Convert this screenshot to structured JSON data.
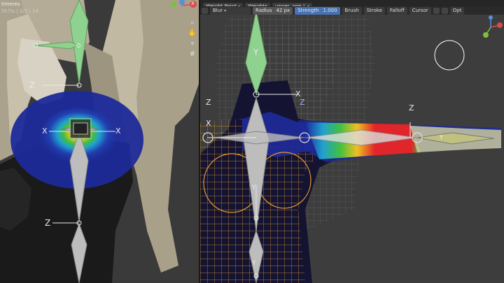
{
  "left_viewport": {
    "info_line1": "timeres",
    "info_line2": "5k7ts | 2/3 | 14",
    "axis_labels": {
      "z1": "Z",
      "x1": "X",
      "x2": "X",
      "z2": "Z"
    },
    "gizmo_axes": {
      "z": "Z",
      "y": "Y",
      "x": "X"
    }
  },
  "right_header": {
    "mode": "Weight Paint",
    "weights_menu": "Weights",
    "object_name": "upper_arm.L",
    "brush_name": "Blur",
    "radius_label": "Radius",
    "radius_value": "42 px",
    "strength_label": "Strength",
    "strength_value": "1.000",
    "menus": [
      "Brush",
      "Stroke",
      "Falloff",
      "Cursor"
    ],
    "options_label": "Opt"
  },
  "right_viewport": {
    "axis_labels": {
      "y_top": "Y",
      "z_top": "Z",
      "x_left": "X",
      "z_left": "Z",
      "z_mid": "Z",
      "x_mid": "X",
      "y_arm": "Y",
      "z_arm": "Z",
      "y_chest": "Y",
      "y_belly": "Y"
    }
  },
  "colors": {
    "bone_selected": "#8fd18f",
    "bone_normal": "#bdbdbd",
    "weight_hot": "#e0262a",
    "weight_cold": "#1e2a9a",
    "wire": "#e89a2c"
  }
}
